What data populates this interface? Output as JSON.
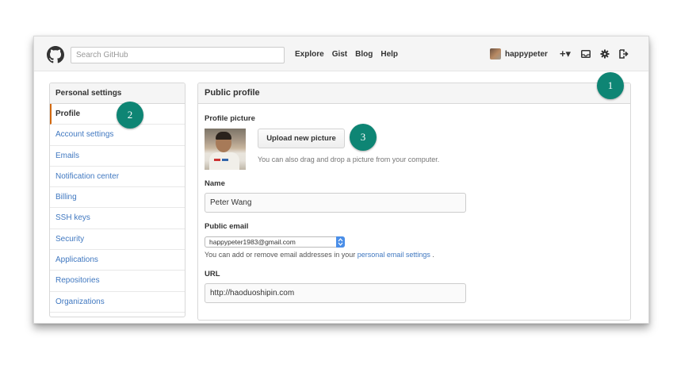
{
  "header": {
    "search_placeholder": "Search GitHub",
    "nav": [
      "Explore",
      "Gist",
      "Blog",
      "Help"
    ],
    "username": "happypeter",
    "plus_glyph": "+▾"
  },
  "sidebar": {
    "title": "Personal settings",
    "items": [
      {
        "label": "Profile",
        "active": true
      },
      {
        "label": "Account settings"
      },
      {
        "label": "Emails"
      },
      {
        "label": "Notification center"
      },
      {
        "label": "Billing"
      },
      {
        "label": "SSH keys"
      },
      {
        "label": "Security"
      },
      {
        "label": "Applications"
      },
      {
        "label": "Repositories"
      },
      {
        "label": "Organizations"
      }
    ]
  },
  "main": {
    "title": "Public profile",
    "picture_label": "Profile picture",
    "upload_button": "Upload new picture",
    "upload_hint": "You can also drag and drop a picture from your computer.",
    "name_label": "Name",
    "name_value": "Peter Wang",
    "email_label": "Public email",
    "email_value": "happypeter1983@gmail.com",
    "email_note_prefix": "You can add or remove email addresses in your",
    "email_note_link": "personal email settings",
    "email_note_suffix": ".",
    "url_label": "URL",
    "url_value": "http://haoduoshipin.com"
  },
  "callouts": [
    "1",
    "2",
    "3"
  ],
  "colors": {
    "callout": "#0e8574",
    "link": "#4078c0",
    "active_border": "#d26911"
  },
  "icons": [
    "github-octocat-icon",
    "plus-icon",
    "inbox-icon",
    "gear-icon",
    "sign-out-icon",
    "select-arrows-icon"
  ]
}
